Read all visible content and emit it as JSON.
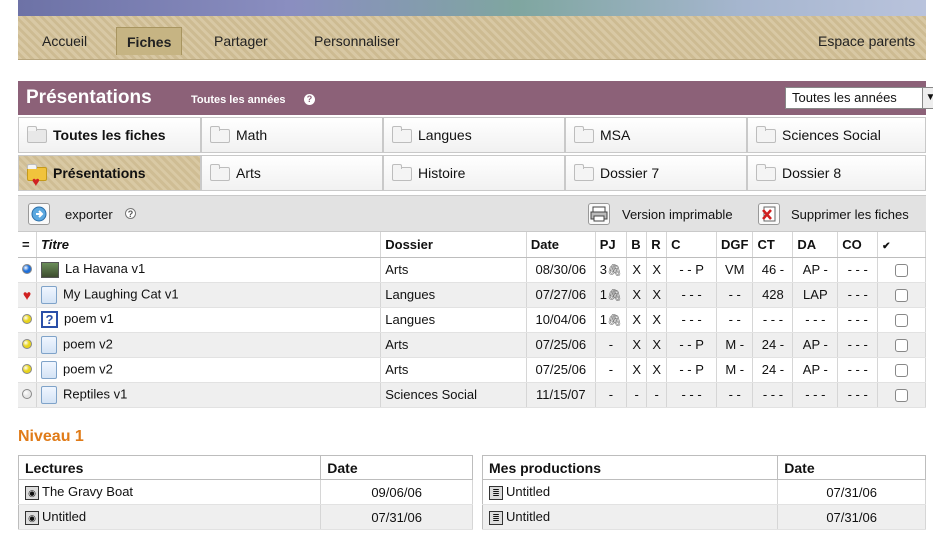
{
  "nav": {
    "items": [
      {
        "label": "Accueil",
        "active": false
      },
      {
        "label": "Fiches",
        "active": true
      },
      {
        "label": "Partager",
        "active": false
      },
      {
        "label": "Personnaliser",
        "active": false
      }
    ],
    "right_item": "Espace parents"
  },
  "header": {
    "title": "Présentations",
    "subtitle": "Toutes les années",
    "year_select": "Toutes les années"
  },
  "folders": {
    "row1": [
      "Toutes les fiches",
      "Math",
      "Langues",
      "MSA",
      "Sciences Social"
    ],
    "row2": [
      "Présentations",
      "Arts",
      "Histoire",
      "Dossier 7",
      "Dossier 8"
    ]
  },
  "toolbar": {
    "export_label": "exporter",
    "print_label": "Version imprimable",
    "delete_label": "Supprimer les fiches"
  },
  "table": {
    "columns": [
      "=",
      "Titre",
      "Dossier",
      "Date",
      "PJ",
      "B",
      "R",
      "C",
      "DGF",
      "CT",
      "DA",
      "CO"
    ],
    "rows": [
      {
        "status": "#1e6fd9",
        "icon": "image",
        "title": "La Havana v1",
        "folder": "Arts",
        "date": "08/30/06",
        "pj": "3",
        "b": "X",
        "r": "X",
        "c": "- - P",
        "dgf": "VM",
        "ct": "46 -",
        "da": "AP -",
        "co": "- - -"
      },
      {
        "status": "heart",
        "icon": "doc",
        "title": "My Laughing Cat v1",
        "folder": "Langues",
        "date": "07/27/06",
        "pj": "1",
        "b": "X",
        "r": "X",
        "c": "- - -",
        "dgf": "- -",
        "ct": "428",
        "da": "LAP",
        "co": "- - -"
      },
      {
        "status": "#e8d41c",
        "icon": "question",
        "title": "poem v1",
        "folder": "Langues",
        "date": "10/04/06",
        "pj": "1",
        "b": "X",
        "r": "X",
        "c": "- - -",
        "dgf": "- -",
        "ct": "- - -",
        "da": "- - -",
        "co": "- - -"
      },
      {
        "status": "#e8d41c",
        "icon": "doc",
        "title": "poem v2",
        "folder": "Arts",
        "date": "07/25/06",
        "pj": "-",
        "b": "X",
        "r": "X",
        "c": "- - P",
        "dgf": "M -",
        "ct": "24 -",
        "da": "AP -",
        "co": "- - -"
      },
      {
        "status": "#e8d41c",
        "icon": "doc",
        "title": "poem v2",
        "folder": "Arts",
        "date": "07/25/06",
        "pj": "-",
        "b": "X",
        "r": "X",
        "c": "- - P",
        "dgf": "M -",
        "ct": "24 -",
        "da": "AP -",
        "co": "- - -"
      },
      {
        "status": "#e6e6e6",
        "icon": "doc",
        "title": "Reptiles v1",
        "folder": "Sciences Social",
        "date": "11/15/07",
        "pj": "-",
        "b": "-",
        "r": "-",
        "c": "- - -",
        "dgf": "- -",
        "ct": "- - -",
        "da": "- - -",
        "co": "- - -"
      }
    ]
  },
  "niveau": {
    "title": "Niveau 1",
    "lectures": {
      "header": "Lectures",
      "date_header": "Date",
      "rows": [
        {
          "title": "The Gravy Boat",
          "date": "09/06/06"
        },
        {
          "title": "Untitled",
          "date": "07/31/06"
        }
      ]
    },
    "productions": {
      "header": "Mes productions",
      "date_header": "Date",
      "rows": [
        {
          "title": "Untitled",
          "date": "07/31/06"
        },
        {
          "title": "Untitled",
          "date": "07/31/06"
        }
      ]
    }
  }
}
